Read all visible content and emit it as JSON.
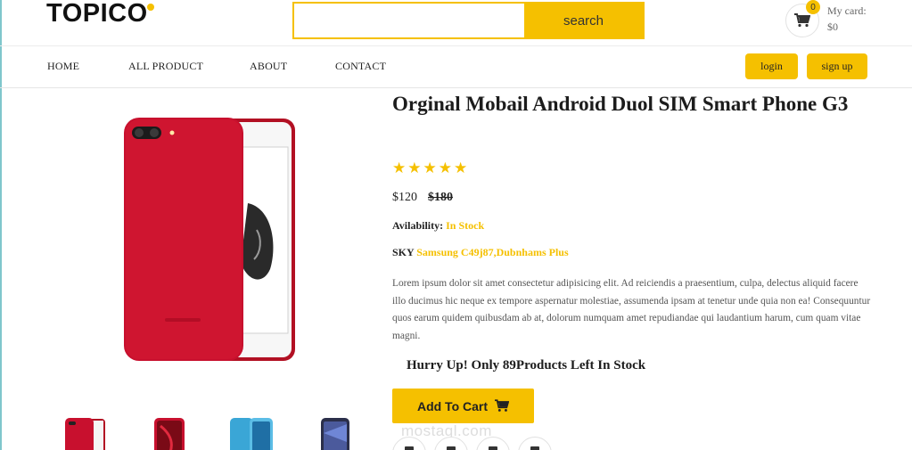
{
  "header": {
    "logo": "TOPICO",
    "search": {
      "placeholder": "",
      "button_label": "search"
    },
    "cart": {
      "badge": "0",
      "label": "My card:",
      "amount": "$0"
    }
  },
  "nav": {
    "items": [
      "HOME",
      "ALL PRODUCT",
      "ABOUT",
      "CONTACT"
    ],
    "login_label": "login",
    "signup_label": "sign up"
  },
  "product": {
    "title": "Orginal Mobail Android Duol SIM Smart Phone G3",
    "rating": 5,
    "price": "$120",
    "old_price": "$180",
    "availability_label": "Avilability:",
    "availability_value": "In Stock",
    "sky_label": "SKY",
    "sky_value": "Samsung C49j87,Dubnhams Plus",
    "description": "Lorem ipsum dolor sit amet consectetur adipisicing elit. Ad reiciendis a praesentium, culpa, delectus aliquid facere illo ducimus hic neque ex tempore aspernatur molestiae, assumenda ipsam at tenetur unde quia non ea! Consequuntur quos earum quidem quibusdam ab at, dolorum numquam amet repudiandae qui laudantium harum, cum quam vitae magni.",
    "stock_note": "Hurry Up! Only 89Products Left In Stock",
    "add_to_cart_label": "Add To Cart",
    "thumbnails": [
      "red-iphone",
      "red-iphone-xr",
      "blue-galaxy",
      "dark-galaxy"
    ]
  },
  "watermark": "mostaql.com",
  "colors": {
    "accent": "#f5c000",
    "phone_red": "#c8102e"
  },
  "icons": {
    "cart": "cart-icon",
    "star": "star-icon",
    "add_to_cart": "cart-icon"
  }
}
